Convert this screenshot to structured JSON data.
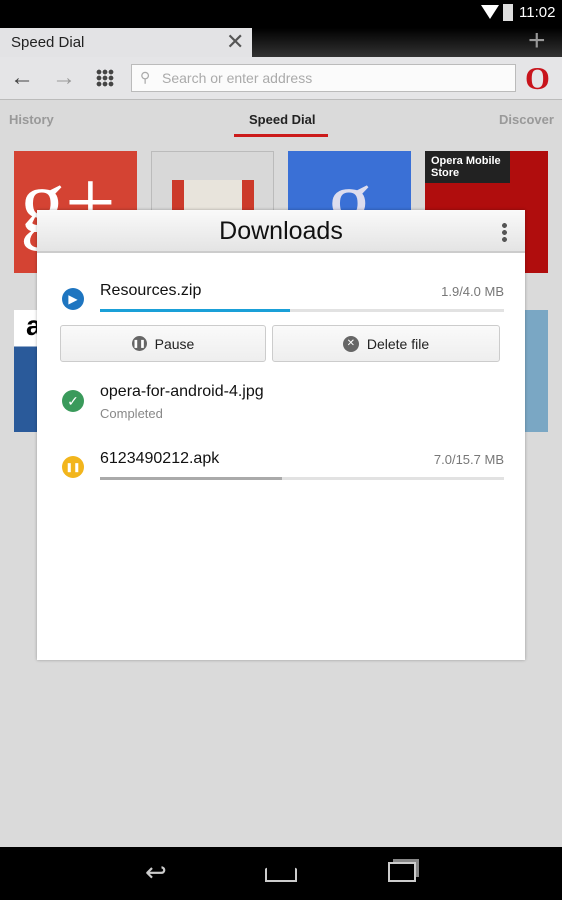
{
  "status_bar": {
    "time": "11:02",
    "icons": [
      "wifi-icon",
      "battery-icon"
    ]
  },
  "tabs": [
    {
      "label": "Speed Dial"
    }
  ],
  "toolbar": {
    "search_placeholder": "Search or enter address"
  },
  "subnav": {
    "items": [
      "History",
      "Speed Dial",
      "Discover"
    ],
    "active": "Speed Dial"
  },
  "speed_dial": {
    "tiles": [
      "Google+",
      "Gmail",
      "Google",
      "Opera Mobile Store",
      "Amazon",
      "",
      "",
      ""
    ],
    "store_label": "Opera\nMobile Store"
  },
  "downloads": {
    "title": "Downloads",
    "items": [
      {
        "name": "Resources.zip",
        "size": "1.9/4.0 MB",
        "progress": 47,
        "state": "downloading",
        "color": "#1e88c8"
      },
      {
        "name": "opera-for-android-4.jpg",
        "status": "Completed",
        "state": "completed",
        "color": "#3a9a5b"
      },
      {
        "name": "6123490212.apk",
        "size": "7.0/15.7 MB",
        "progress": 45,
        "state": "paused",
        "color": "#f2b51c"
      }
    ],
    "pause_label": "Pause",
    "delete_label": "Delete file"
  },
  "colors": {
    "accent": "#cc1b1b",
    "progress": "#1aa0d8"
  }
}
